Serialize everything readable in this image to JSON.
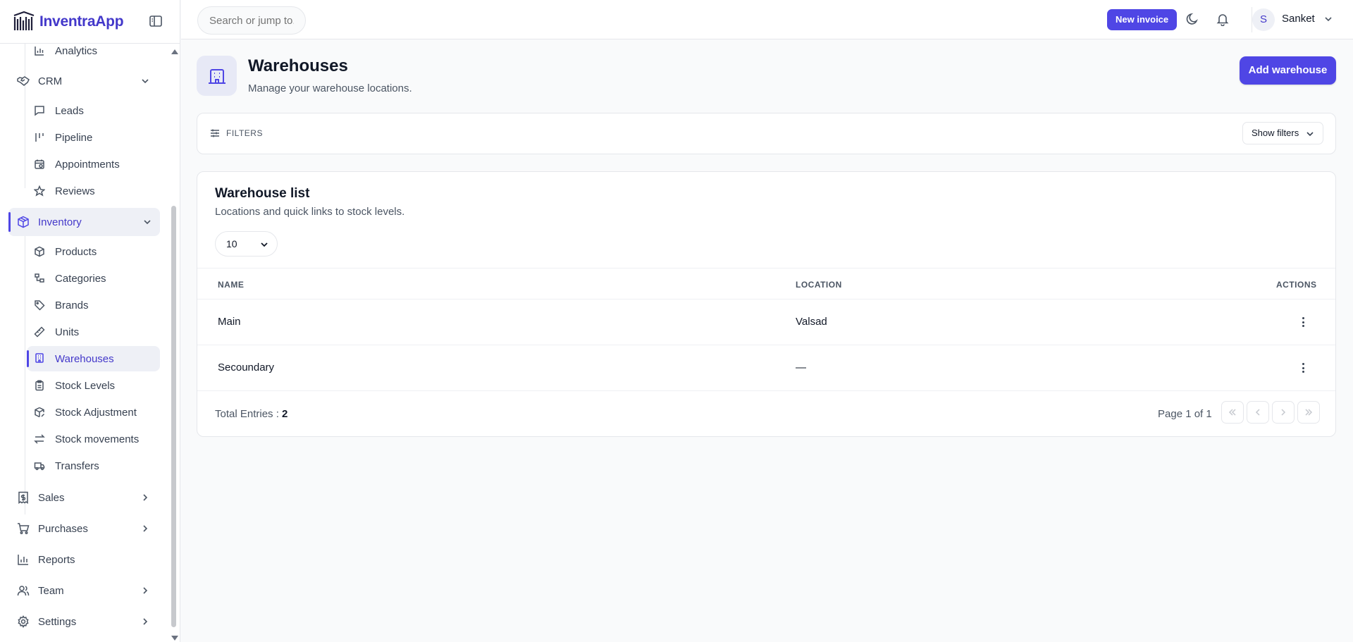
{
  "brand": {
    "name_part1": "Inventra",
    "name_part2": "App"
  },
  "search": {
    "placeholder": "Search or jump to..."
  },
  "header": {
    "new_invoice_label": "New invoice",
    "user": {
      "initial": "S",
      "name": "Sanket"
    }
  },
  "sidebar": {
    "items": [
      {
        "label": "Analytics",
        "icon": "bar-chart-icon"
      },
      {
        "label": "CRM",
        "icon": "handshake-icon"
      },
      {
        "label": "Leads",
        "icon": "message-square-icon"
      },
      {
        "label": "Pipeline",
        "icon": "kanban-icon"
      },
      {
        "label": "Appointments",
        "icon": "calendar-clock-icon"
      },
      {
        "label": "Reviews",
        "icon": "star-icon"
      },
      {
        "label": "Inventory",
        "icon": "package-icon"
      },
      {
        "label": "Products",
        "icon": "box-icon"
      },
      {
        "label": "Categories",
        "icon": "category-tree-icon"
      },
      {
        "label": "Brands",
        "icon": "tag-icon"
      },
      {
        "label": "Units",
        "icon": "ruler-icon"
      },
      {
        "label": "Warehouses",
        "icon": "building-icon"
      },
      {
        "label": "Stock Levels",
        "icon": "clipboard-icon"
      },
      {
        "label": "Stock Adjustment",
        "icon": "package-edit-icon"
      },
      {
        "label": "Stock movements",
        "icon": "arrows-exchange-icon"
      },
      {
        "label": "Transfers",
        "icon": "truck-icon"
      },
      {
        "label": "Sales",
        "icon": "receipt-dollar-icon"
      },
      {
        "label": "Purchases",
        "icon": "shopping-cart-icon"
      },
      {
        "label": "Reports",
        "icon": "bar-chart-icon"
      },
      {
        "label": "Team",
        "icon": "users-icon"
      },
      {
        "label": "Settings",
        "icon": "gear-icon"
      }
    ]
  },
  "page": {
    "title": "Warehouses",
    "subtitle": "Manage your warehouse locations.",
    "add_button_label": "Add warehouse"
  },
  "filters": {
    "label": "FILTERS",
    "toggle_label": "Show filters"
  },
  "list": {
    "title": "Warehouse list",
    "subtitle": "Locations and quick links to stock levels.",
    "page_size": "10",
    "columns": [
      "NAME",
      "LOCATION",
      "ACTIONS"
    ],
    "rows": [
      {
        "name": "Main",
        "location": "Valsad"
      },
      {
        "name": "Secoundary",
        "location": "—"
      }
    ],
    "total_label": "Total Entries :",
    "total_count": "2",
    "page_info": "Page 1 of 1"
  },
  "colors": {
    "accent": "#4f46e5",
    "active_bg": "#eef0f6",
    "page_bg": "#f9fafb"
  }
}
